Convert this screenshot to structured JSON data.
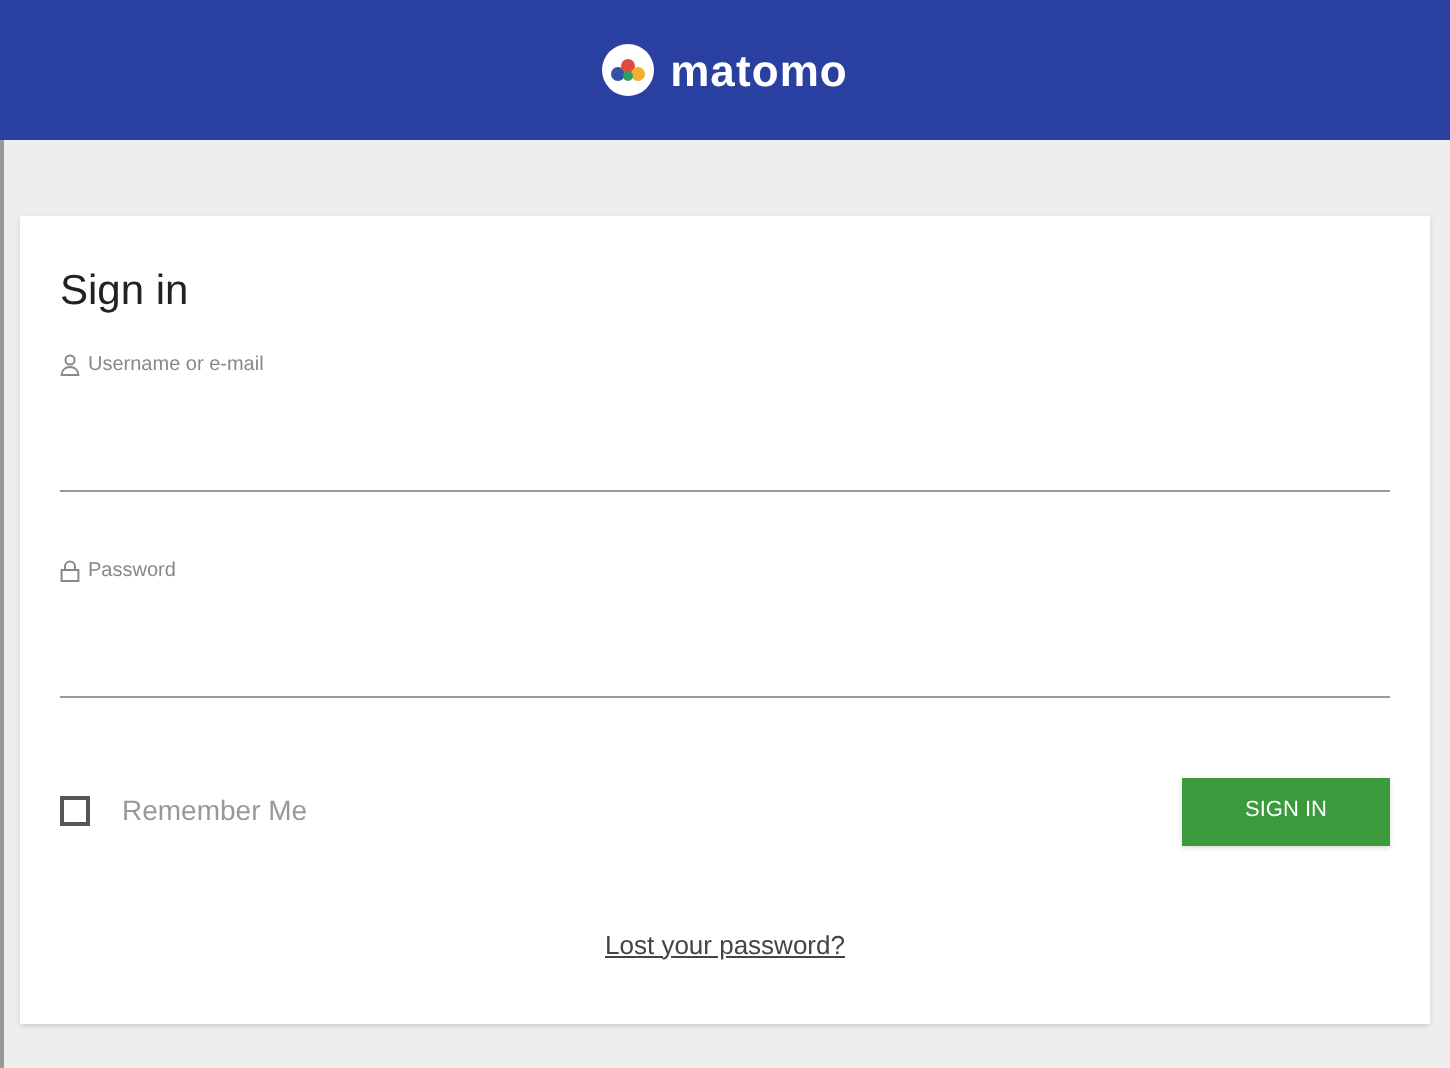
{
  "header": {
    "brand": "matomo"
  },
  "form": {
    "title": "Sign in",
    "fields": [
      {
        "kind": "text",
        "placeholder": "Username or e-mail"
      },
      {
        "kind": "password",
        "placeholder": "Password"
      }
    ],
    "remember": {
      "label": "Remember Me",
      "checked": false
    },
    "submit": "SIGN IN",
    "lost_password": "Lost your password?"
  }
}
